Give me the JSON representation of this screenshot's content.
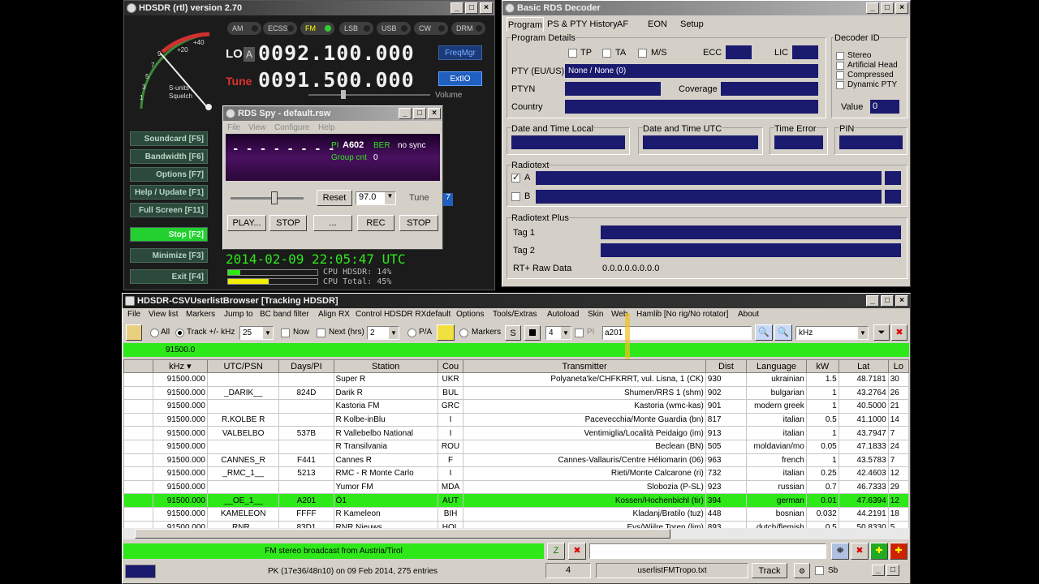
{
  "hdsdr": {
    "title": "HDSDR (rtl)  version 2.70",
    "modes": [
      "AM",
      "ECSS",
      "FM",
      "LSB",
      "USB",
      "CW",
      "DRM"
    ],
    "lo_label": "LO",
    "lo_a": "A",
    "lo_freq": "0092.100.000",
    "tune_label": "Tune",
    "tune_freq": "0091.500.000",
    "freqmgr": "FreqMgr",
    "extio": "ExtIO",
    "volume": "Volume",
    "smeter_labels": [
      "+40",
      "+20",
      "9",
      "7",
      "5",
      "3",
      "1"
    ],
    "smeter_sub": "S-units",
    "squelch": "Squelch",
    "buttons": [
      "Soundcard [F5]",
      "Bandwidth [F6]",
      "Options [F7]",
      "Help / Update [F1]",
      "Full Screen [F11]",
      "Stop [F2]",
      "Minimize [F3]",
      "Exit [F4]"
    ],
    "datetime": "2014-02-09  22:05:47 UTC",
    "cpu_hdsdr": "CPU HDSDR:  14%",
    "cpu_total": "CPU Total:  45%"
  },
  "rdsspy": {
    "title": "RDS Spy - default.rsw",
    "menu": [
      "File",
      "View",
      "Configure",
      "Help"
    ],
    "ps": "- - - - - - - -",
    "pi_label": "PI",
    "pi": "A602",
    "ber": "BER",
    "sync": "no sync",
    "group_cnt_label": "Group cnt",
    "group_cnt": "0",
    "reset": "Reset",
    "freq": "97.0",
    "tune": "Tune",
    "play": "PLAY...",
    "stop1": "STOP",
    "dots": "...",
    "rec": "REC",
    "stop2": "STOP"
  },
  "rds": {
    "title": "Basic RDS Decoder",
    "tabs": [
      "Program",
      "PS & PTY History",
      "AF",
      "EON",
      "Setup"
    ],
    "program_details": "Program Details",
    "tp": "TP",
    "ta": "TA",
    "ms": "M/S",
    "ecc": "ECC",
    "lic": "LIC",
    "pty_label": "PTY (EU/US)",
    "pty_value": "None / None (0)",
    "ptyn": "PTYN",
    "coverage": "Coverage",
    "country": "Country",
    "decoder_id": "Decoder ID",
    "decoder_items": [
      "Stereo",
      "Artificial Head",
      "Compressed",
      "Dynamic PTY"
    ],
    "value_label": "Value",
    "value": "0",
    "dt_local": "Date and Time Local",
    "dt_utc": "Date and Time UTC",
    "time_error": "Time Error",
    "pin": "PIN",
    "radiotext": "Radiotext",
    "rt_a": "A",
    "rt_b": "B",
    "rt_plus": "Radiotext Plus",
    "tag1": "Tag 1",
    "tag2": "Tag 2",
    "rt_raw": "RT+ Raw Data",
    "rt_raw_value": "0.0.0.0.0.0.0.0"
  },
  "csv": {
    "title": "HDSDR-CSVUserlistBrowser [Tracking HDSDR]",
    "menu": [
      "File",
      "View list",
      "Markers",
      "Jump to",
      "BC band filter",
      "Align RX",
      "Control HDSDR RXdefault",
      "Options",
      "Tools/Extras",
      "Autoload",
      "Skin",
      "Web",
      "Hamlib [No rig/No rotator]",
      "About"
    ],
    "all": "All",
    "track": "Track +/- kHz",
    "track_val": "25",
    "now": "Now",
    "next": "Next (hrs)",
    "next_val": "2",
    "pa": "P/A",
    "markers": "Markers",
    "s": "S",
    "num": "4",
    "pi": "PI",
    "search_value": "a201",
    "unit": "kHz",
    "freq_bar": "91500.0",
    "columns": [
      "kHz ▾",
      "UTC/PSN",
      "Days/PI",
      "Station",
      "Cou",
      "Transmitter",
      "Dist",
      "Language",
      "kW",
      "Lat",
      "Lo"
    ],
    "rows": [
      [
        "91500.000",
        "",
        "",
        "Super R",
        "UKR",
        "Polyaneta'ke/CHFKRRT, vul. Lisna, 1 (CK)",
        "930",
        "ukrainian",
        "1.5",
        "48.7181",
        "30"
      ],
      [
        "91500.000",
        "_DARIK__",
        "824D",
        "Darik R",
        "BUL",
        "Shumen/RRS 1 (shm)",
        "902",
        "bulgarian",
        "1",
        "43.2764",
        "26"
      ],
      [
        "91500.000",
        "",
        "",
        "Kastoria FM",
        "GRC",
        "Kastoria (wmc-kas)",
        "901",
        "modern greek",
        "1",
        "40.5000",
        "21"
      ],
      [
        "91500.000",
        "R.KOLBE R",
        "",
        "R Kolbe-inBlu",
        "I",
        "Pacevecchia/Monte Guardia (bn)",
        "817",
        "italian",
        "0.5",
        "41.1000",
        "14"
      ],
      [
        "91500.000",
        "VALBELBO",
        "537B",
        "R Vallebelbo National",
        "I",
        "Ventimiglia/Località Peidaigo (im)",
        "913",
        "italian",
        "1",
        "43.7947",
        "7"
      ],
      [
        "91500.000",
        "",
        "",
        "R Transilvania",
        "ROU",
        "Beclean (BN)",
        "505",
        "moldavian/mo",
        "0.05",
        "47.1833",
        "24"
      ],
      [
        "91500.000",
        "CANNES_R",
        "F441",
        "Cannes R",
        "F",
        "Cannes-Vallauris/Centre Héliomarin (06)",
        "963",
        "french",
        "1",
        "43.5783",
        "7"
      ],
      [
        "91500.000",
        "_RMC_1__",
        "5213",
        "RMC - R Monte Carlo",
        "I",
        "Rieti/Monte Calcarone (ri)",
        "732",
        "italian",
        "0.25",
        "42.4603",
        "12"
      ],
      [
        "91500.000",
        "",
        "",
        "Yumor FM",
        "MDA",
        "Slobozia (P-SL)",
        "923",
        "russian",
        "0.7",
        "46.7333",
        "29"
      ],
      [
        "91500.000",
        "__OE_1__",
        "A201",
        "Ö1",
        "AUT",
        "Kossen/Hochenbichl (tir)",
        "394",
        "german",
        "0.01",
        "47.6394",
        "12"
      ],
      [
        "91500.000",
        "KAMELEON",
        "FFFF",
        "R Kameleon",
        "BIH",
        "Kladanj/Bratilo (tuz)",
        "448",
        "bosnian",
        "0.032",
        "44.2191",
        "18"
      ],
      [
        "91500.000",
        "_RNR__",
        "83D1",
        "RNR Nieuws",
        "HOL",
        "Eys/Wijlre Toren (lim)",
        "893",
        "dutch/flemish",
        "0.5",
        "50.8330",
        "5"
      ]
    ],
    "status_text": "FM stereo broadcast from Austria/Tirol",
    "footer_info": "PK (17e36/48n10) on 09 Feb 2014, 275 entries",
    "footer_num": "4",
    "footer_file": "userlistFMTropo.txt",
    "track_btn": "Track",
    "footer_sb": "Sb"
  },
  "colors": {
    "accent_green": "#2ee81a",
    "navy": "#1a1a6e",
    "digit_white": "#f0f0f0",
    "tune_red": "#e03030"
  }
}
